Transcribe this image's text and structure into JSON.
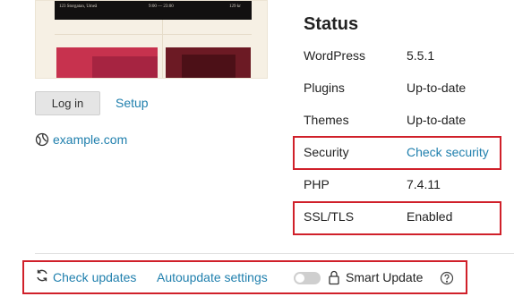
{
  "thumbnail": {
    "header_texts": [
      "123 Storgatan, Umeå",
      "9:00 — 23:00",
      "129 kr"
    ],
    "colors": {
      "bg": "#f6f0e4",
      "header": "#121010",
      "red": "#c7324e",
      "maroon": "#6c1a24"
    }
  },
  "actions": {
    "login_label": "Log in",
    "setup_label": "Setup",
    "domain_icon": "globe-icon",
    "domain": "example.com"
  },
  "status": {
    "title": "Status",
    "rows": [
      {
        "label": "WordPress",
        "value": "5.5.1"
      },
      {
        "label": "Plugins",
        "value": "Up-to-date"
      },
      {
        "label": "Themes",
        "value": "Up-to-date"
      },
      {
        "label": "Security",
        "value": "Check security"
      },
      {
        "label": "PHP",
        "value": "7.4.11"
      },
      {
        "label": "SSL/TLS",
        "value": "Enabled"
      }
    ]
  },
  "footer": {
    "check_updates_icon": "refresh-icon",
    "check_updates_label": "Check updates",
    "autoupdate_label": "Autoupdate settings",
    "smart_update_toggle": false,
    "smart_update_icon": "lock-icon",
    "smart_update_label": "Smart Update",
    "help_icon": "help-circle-icon"
  },
  "colors": {
    "link": "#1f7fad",
    "highlight": "#d0202a"
  }
}
